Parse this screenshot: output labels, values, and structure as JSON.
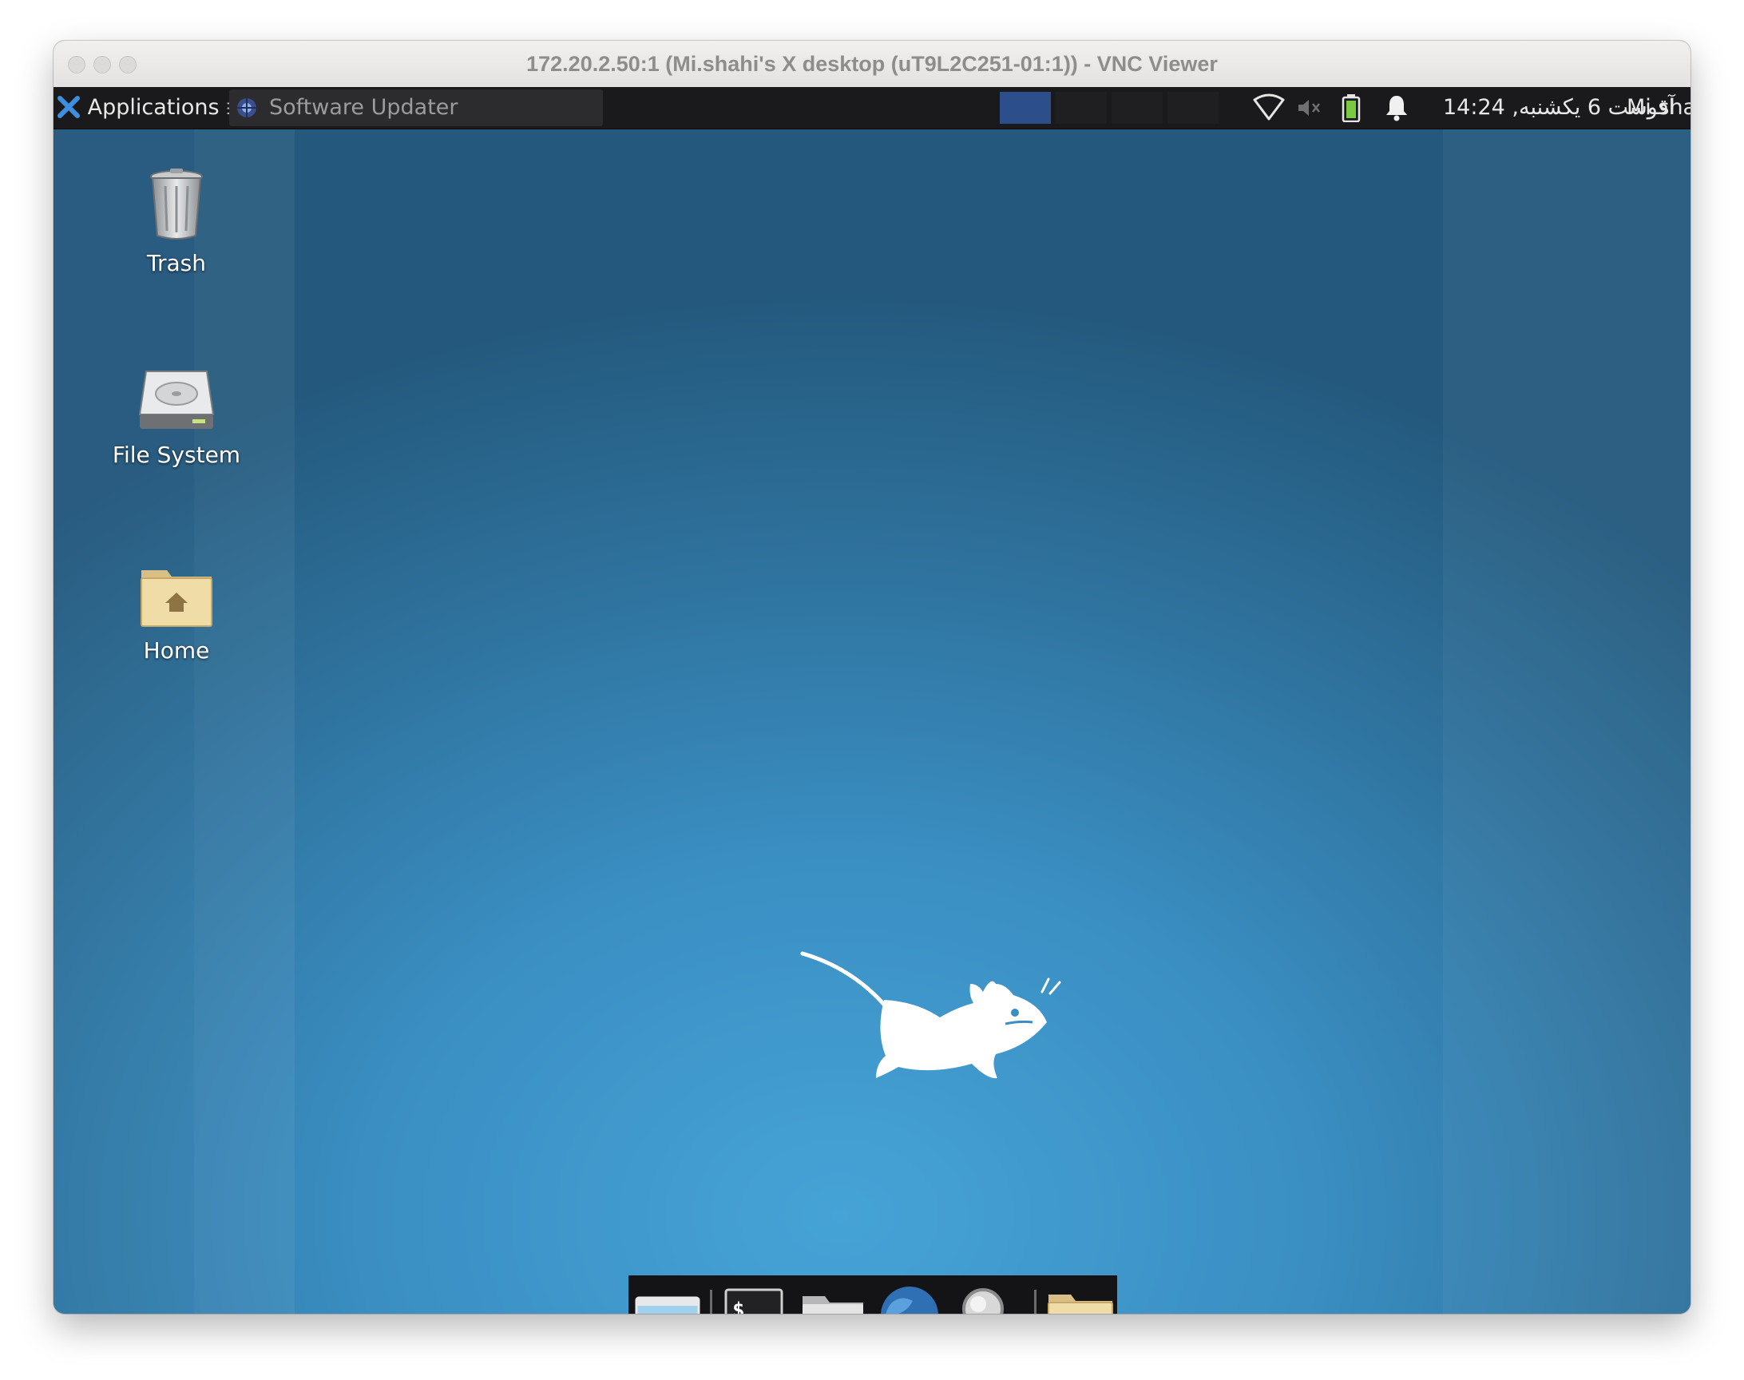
{
  "window": {
    "title": "172.20.2.50:1 (Mi.shahi's X desktop (uT9L2C251-01:1)) - VNC Viewer"
  },
  "panel": {
    "applications_label": "Applications",
    "menu_glyph": "☰",
    "task_label": "Software Updater",
    "clock": "14:24 ,آقوست 6 یکشنبه",
    "user": "Mi.shahi"
  },
  "desktop_icons": [
    {
      "label": "Trash",
      "icon": "trash-icon"
    },
    {
      "label": "File System",
      "icon": "hard-drive-icon"
    },
    {
      "label": "Home",
      "icon": "home-folder-icon"
    }
  ],
  "dock": [
    {
      "icon": "show-desktop-icon"
    },
    {
      "icon": "terminal-icon",
      "glyph": "$_"
    },
    {
      "icon": "file-manager-icon"
    },
    {
      "icon": "web-browser-icon"
    },
    {
      "icon": "app-finder-icon"
    },
    {
      "icon": "folder-icon"
    }
  ],
  "colors": {
    "panel_bg": "#1a1a1c",
    "active_workspace": "#2c4f8c",
    "desktop_center": "#46a3d6",
    "desktop_edge": "#24597d"
  }
}
